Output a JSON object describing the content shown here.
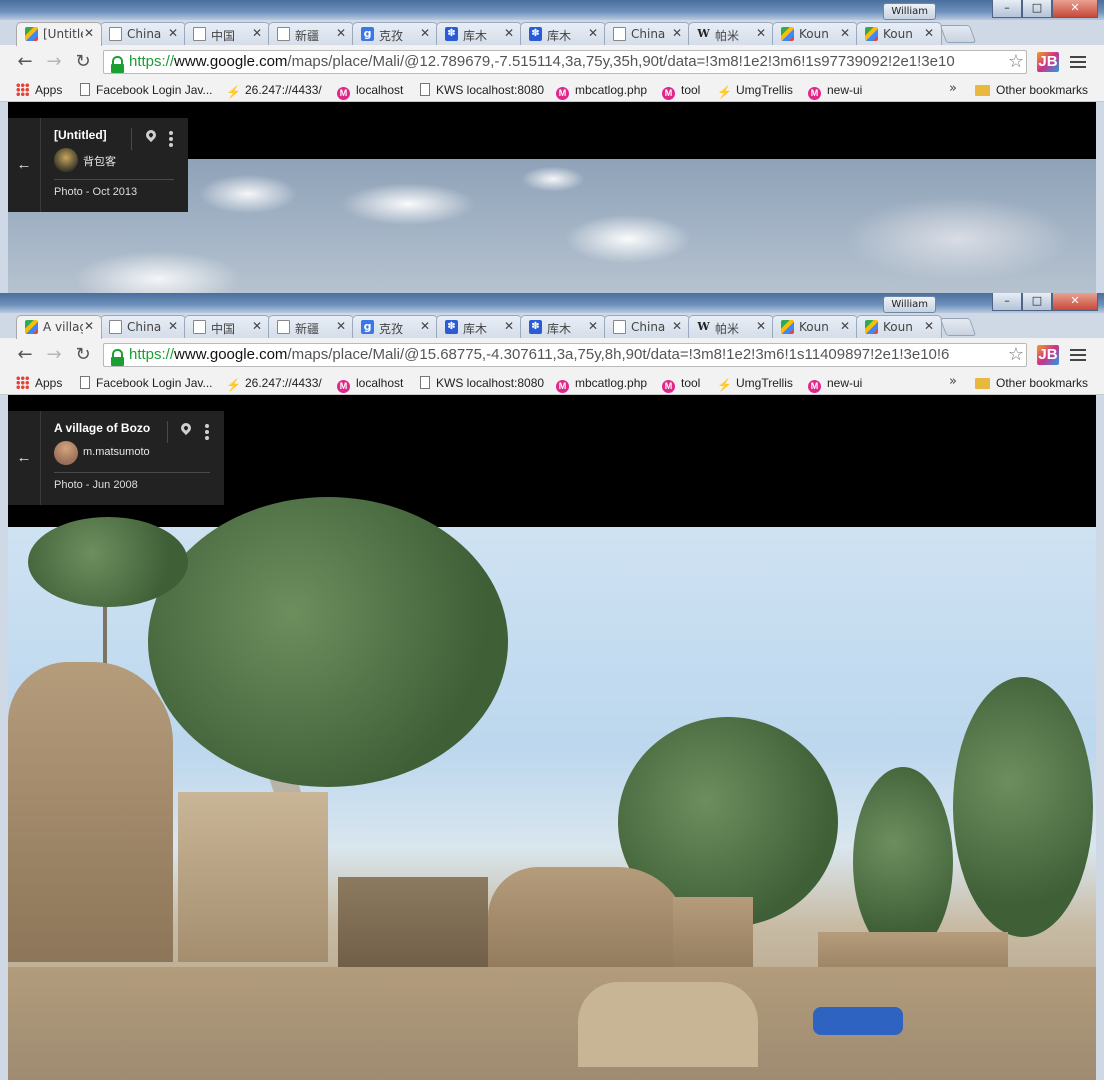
{
  "window1": {
    "user": "William",
    "tabs": [
      {
        "label": "[Untitled]",
        "icon": "google-maps-icon",
        "active": true
      },
      {
        "label": "China",
        "icon": "document-icon"
      },
      {
        "label": "中国",
        "icon": "document-icon"
      },
      {
        "label": "新疆",
        "icon": "document-icon"
      },
      {
        "label": "克孜",
        "icon": "google-icon"
      },
      {
        "label": "库木",
        "icon": "baidu-icon"
      },
      {
        "label": "库木",
        "icon": "baidu-icon"
      },
      {
        "label": "China",
        "icon": "document-icon"
      },
      {
        "label": "帕米",
        "icon": "wikipedia-icon"
      },
      {
        "label": "Koun",
        "icon": "google-maps-icon"
      },
      {
        "label": "Koun",
        "icon": "google-maps-icon"
      }
    ],
    "url": {
      "scheme": "https://",
      "host": "www.google.com",
      "path": "/maps/place/Mali/@12.789679,-7.515114,3a,75y,35h,90t/data=!3m8!1e2!3m6!1s97739092!2e1!3e10"
    },
    "info": {
      "title": "[Untitled]",
      "author": "背包客",
      "date": "Photo - Oct 2013"
    }
  },
  "window2": {
    "user": "William",
    "tabs": [
      {
        "label": "A village of Bozo",
        "icon": "google-maps-icon",
        "active": true
      },
      {
        "label": "China",
        "icon": "document-icon"
      },
      {
        "label": "中国",
        "icon": "document-icon"
      },
      {
        "label": "新疆",
        "icon": "document-icon"
      },
      {
        "label": "克孜",
        "icon": "google-icon"
      },
      {
        "label": "库木",
        "icon": "baidu-icon"
      },
      {
        "label": "库木",
        "icon": "baidu-icon"
      },
      {
        "label": "China",
        "icon": "document-icon"
      },
      {
        "label": "帕米",
        "icon": "wikipedia-icon"
      },
      {
        "label": "Koun",
        "icon": "google-maps-icon"
      },
      {
        "label": "Koun",
        "icon": "google-maps-icon"
      }
    ],
    "url": {
      "scheme": "https://",
      "host": "www.google.com",
      "path": "/maps/place/Mali/@15.68775,-4.307611,3a,75y,8h,90t/data=!3m8!1e2!3m6!1s11409897!2e1!3e10!6"
    },
    "info": {
      "title": "A village of Bozo",
      "author": "m.matsumoto",
      "date": "Photo - Jun 2008"
    }
  },
  "bookmarks": [
    {
      "label": "Apps",
      "icon": "apps-icon"
    },
    {
      "label": "Facebook Login Jav...",
      "icon": "document-icon"
    },
    {
      "label": "26.247://4433/",
      "icon": "trello-icon"
    },
    {
      "label": "localhost",
      "icon": "pink-m-icon"
    },
    {
      "label": "KWS localhost:8080",
      "icon": "document-icon"
    },
    {
      "label": "mbcatlog.php",
      "icon": "pink-m-icon"
    },
    {
      "label": "tool",
      "icon": "pink-m-icon"
    },
    {
      "label": "UmgTrellis",
      "icon": "trello-icon"
    },
    {
      "label": "new-ui",
      "icon": "pink-m-icon"
    }
  ],
  "bookmarks_overflow": "»",
  "other_bookmarks": "Other bookmarks",
  "window_controls": {
    "minimize": "–",
    "maximize": "□",
    "close": "✕"
  },
  "extension_label": "JB",
  "back_arrow": "←"
}
